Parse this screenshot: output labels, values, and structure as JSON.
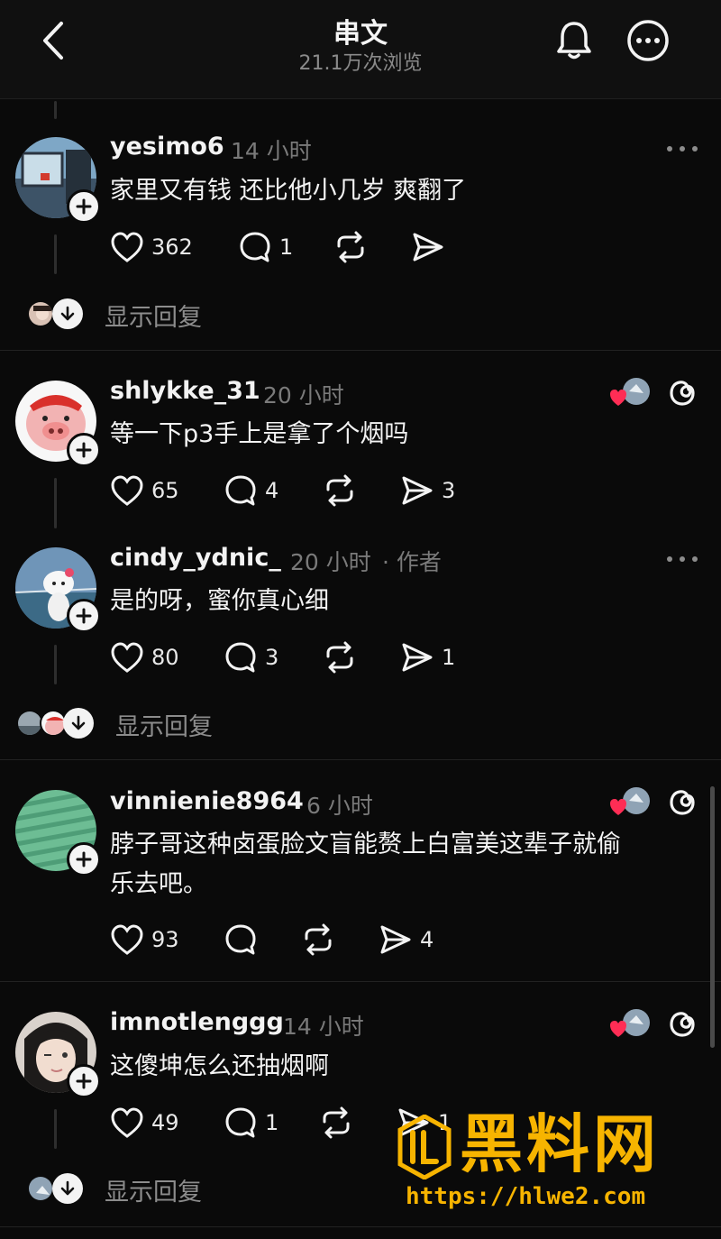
{
  "header": {
    "title": "串文",
    "subtitle": "21.1万次浏览"
  },
  "comments": [
    {
      "username": "yesimo6",
      "time": "14 小时",
      "text": "家里又有钱 还比他小几岁 爽翻了",
      "likes": "362",
      "replies": "1",
      "shares": "",
      "show_replies": "显示回复"
    },
    {
      "username": "shlykke_31",
      "time": "20 小时",
      "text": "等一下p3手上是拿了个烟吗",
      "likes": "65",
      "replies": "4",
      "shares": "3"
    },
    {
      "username": "cindy_ydnic_",
      "time": "20 小时",
      "author_tag": "· 作者",
      "text": "是的呀，蜜你真心细",
      "likes": "80",
      "replies": "3",
      "shares": "1",
      "show_replies": "显示回复"
    },
    {
      "username": "vinnienie8964",
      "time": "6 小时",
      "text_line1": "脖子哥这种卤蛋脸文盲能赘上白富美这辈子就偷",
      "text_line2": "乐去吧。",
      "likes": "93",
      "replies": "",
      "shares": "4"
    },
    {
      "username": "imnotlenggg",
      "time": "14 小时",
      "text": "这傻坤怎么还抽烟啊",
      "likes": "49",
      "replies": "1",
      "shares": "1",
      "show_replies": "显示回复"
    }
  ],
  "watermark": {
    "brand": "黑料网",
    "url": "https://hlwe2.com"
  },
  "colors": {
    "background": "#0a0a0a",
    "text": "#f3f3f3",
    "muted": "#7a7a7a",
    "like_red": "#ff2d55",
    "watermark": "#f7b400"
  }
}
